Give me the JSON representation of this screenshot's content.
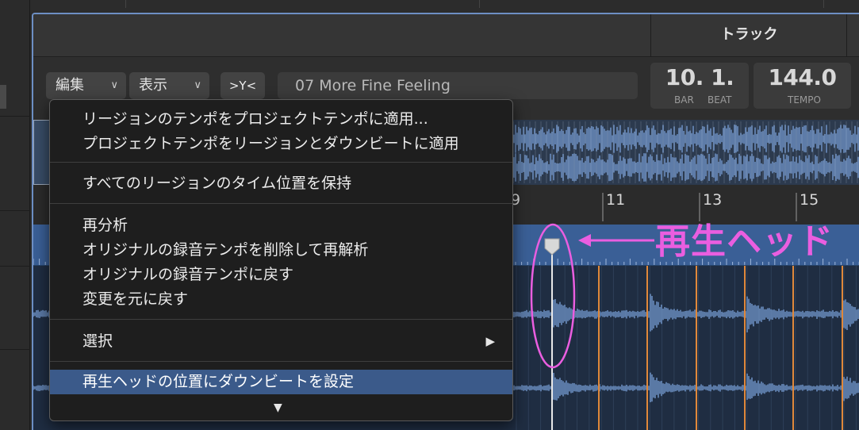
{
  "header": {
    "track_label": "トラック"
  },
  "toolbar": {
    "edit_label": "編集",
    "view_label": "表示",
    "catch_label": ">Y<",
    "region_name": "07 More Fine Feeling"
  },
  "lcd": {
    "position_value": "10. 1.",
    "bar_label": "BAR",
    "beat_label": "BEAT",
    "tempo_value": "144.0",
    "tempo_label": "TEMPO"
  },
  "ruler": {
    "labels": [
      "9",
      "11",
      "13",
      "15"
    ]
  },
  "annotation": {
    "label": "再生ヘッド",
    "color": "#ea5ee0"
  },
  "menu": {
    "items": [
      {
        "label": "リージョンのテンポをプロジェクトテンポに適用..."
      },
      {
        "label": "プロジェクトテンポをリージョンとダウンビートに適用"
      },
      {
        "label": "すべてのリージョンのタイム位置を保持"
      },
      {
        "label": "再分析"
      },
      {
        "label": "オリジナルの録音テンポを削除して再解析"
      },
      {
        "label": "オリジナルの録音テンポに戻す"
      },
      {
        "label": "変更を元に戻す"
      },
      {
        "label": "選択"
      },
      {
        "label": "再生ヘッドの位置にダウンビートを設定"
      }
    ]
  },
  "colors": {
    "selection_border": "#6d8fc4",
    "menu_highlight": "#3b5a8a",
    "beat_marker": "#e0883a",
    "waveform": "#6f93c6"
  },
  "icons": {
    "chevron": "chevron-down-icon",
    "submenu": "chevron-right-icon",
    "scroll_more": "triangle-down-icon"
  }
}
